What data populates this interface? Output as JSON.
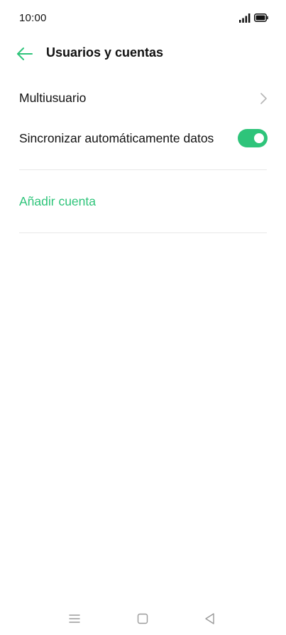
{
  "status_bar": {
    "time": "10:00",
    "signal_icon": "signal-bars-icon",
    "battery_icon": "battery-full-icon"
  },
  "app_bar": {
    "back_icon": "arrow-left-icon",
    "title": "Usuarios y cuentas"
  },
  "list": {
    "multiuser": {
      "label": "Multiusuario",
      "icon": "chevron-right-icon"
    },
    "auto_sync": {
      "label": "Sincronizar automáticamente datos",
      "enabled": true
    },
    "add_account": {
      "label": "Añadir cuenta"
    }
  },
  "nav_bar": {
    "items": [
      "menu-icon",
      "home-icon",
      "back-icon"
    ]
  },
  "colors": {
    "accent": "#2ec47a",
    "text": "#111111",
    "divider": "#e8e8e8",
    "icon_gray": "#9a9a9a"
  }
}
